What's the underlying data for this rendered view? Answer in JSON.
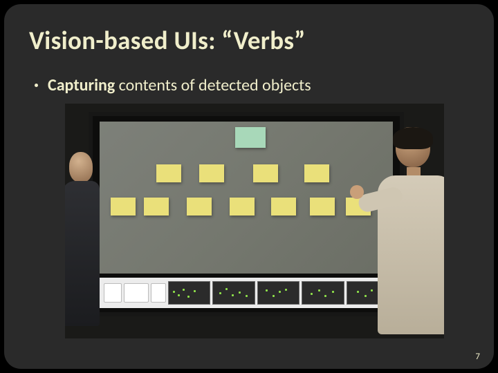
{
  "slide": {
    "title": "Vision-based UIs: “Verbs”",
    "bullet_strong": "Capturing",
    "bullet_rest": " contents of detected objects",
    "page_number": "7"
  }
}
